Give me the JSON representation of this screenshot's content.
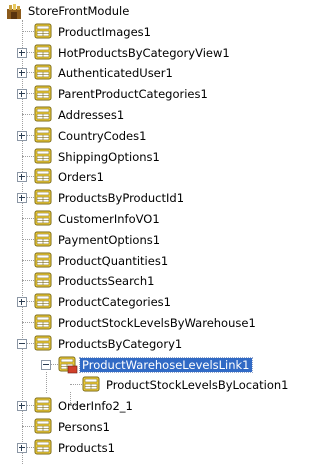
{
  "tree": {
    "root": {
      "label": "StoreFrontModule",
      "icon": "module-icon"
    },
    "items": [
      {
        "label": "ProductImages1",
        "expander": "none"
      },
      {
        "label": "HotProductsByCategoryView1",
        "expander": "plus"
      },
      {
        "label": "AuthenticatedUser1",
        "expander": "plus"
      },
      {
        "label": "ParentProductCategories1",
        "expander": "plus"
      },
      {
        "label": "Addresses1",
        "expander": "none"
      },
      {
        "label": "CountryCodes1",
        "expander": "plus"
      },
      {
        "label": "ShippingOptions1",
        "expander": "none"
      },
      {
        "label": "Orders1",
        "expander": "plus"
      },
      {
        "label": "ProductsByProductId1",
        "expander": "plus"
      },
      {
        "label": "CustomerInfoVO1",
        "expander": "none"
      },
      {
        "label": "PaymentOptions1",
        "expander": "none"
      },
      {
        "label": "ProductQuantities1",
        "expander": "none"
      },
      {
        "label": "ProductsSearch1",
        "expander": "none"
      },
      {
        "label": "ProductCategories1",
        "expander": "plus"
      },
      {
        "label": "ProductStockLevelsByWarehouse1",
        "expander": "none"
      },
      {
        "label": "ProductsByCategory1",
        "expander": "minus",
        "children": [
          {
            "label": "ProductWarehoseLevelsLink1",
            "expander": "minus",
            "selected": true,
            "icon": "view-link-icon",
            "children": [
              {
                "label": "ProductStockLevelsByLocation1",
                "expander": "none"
              }
            ]
          }
        ]
      },
      {
        "label": "OrderInfo2_1",
        "expander": "plus"
      },
      {
        "label": "Persons1",
        "expander": "none"
      },
      {
        "label": "Products1",
        "expander": "plus"
      }
    ]
  },
  "colors": {
    "selection_bg": "#316ac5",
    "selection_text": "#ffffff",
    "tree_lines": "#a0a0a0",
    "view_icon_yellow": "#f5d23a",
    "module_icon_brown": "#8b5a1c"
  }
}
